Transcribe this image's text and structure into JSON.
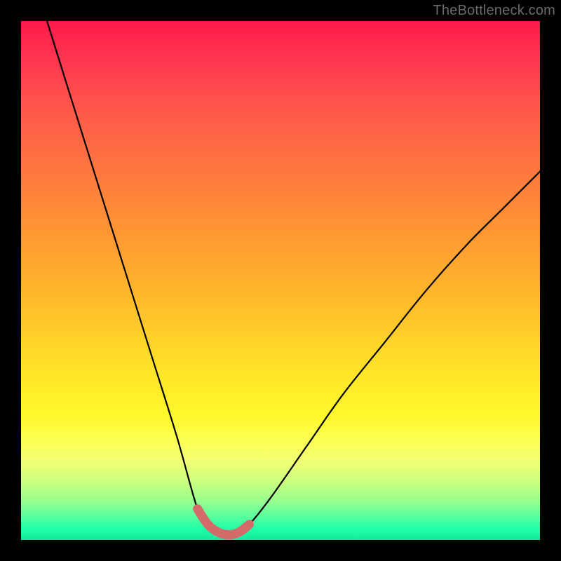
{
  "watermark": "TheBottleneck.com",
  "colors": {
    "background": "#000000",
    "curve_main": "#000000",
    "curve_highlight": "#d46a6a",
    "gradient_top": "#ff1a4a",
    "gradient_bottom": "#15e89c"
  },
  "chart_data": {
    "type": "line",
    "title": "",
    "xlabel": "",
    "ylabel": "",
    "xlim": [
      0,
      100
    ],
    "ylim": [
      0,
      100
    ],
    "grid": false,
    "legend": false,
    "description": "Bottleneck-style V-curve. Y is rendered inverted so lower values appear at the bottom of the plot. Left branch descends quickly; right branch rises more slowly. Flat minimum region near x ≈ 34–44 is highlighted with a thick muted-red stroke.",
    "series": [
      {
        "name": "curve",
        "x": [
          5,
          10,
          15,
          20,
          25,
          30,
          34,
          36,
          38,
          40,
          42,
          44,
          48,
          55,
          62,
          70,
          78,
          86,
          93,
          100
        ],
        "y": [
          100,
          84,
          68,
          52,
          36,
          20,
          6,
          3,
          1.5,
          1,
          1.5,
          3,
          8,
          18,
          28,
          38,
          48,
          57,
          64,
          71
        ]
      },
      {
        "name": "highlight-minimum",
        "x": [
          34,
          36,
          38,
          40,
          42,
          44
        ],
        "y": [
          6,
          3,
          1.5,
          1,
          1.5,
          3
        ]
      }
    ]
  }
}
